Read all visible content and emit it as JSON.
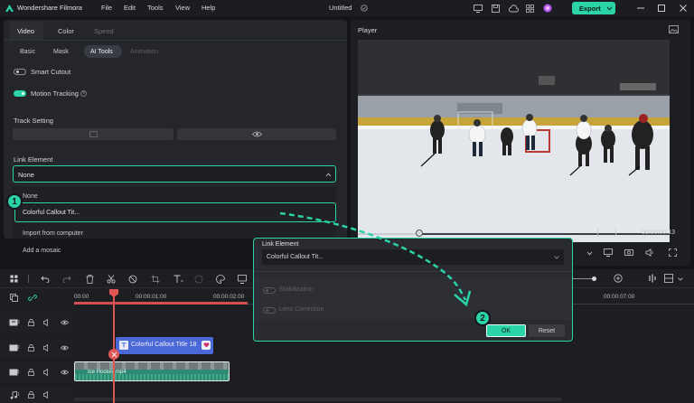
{
  "app": {
    "name": "Wondershare Filmora",
    "project_title": "Untitled",
    "accent": "#2ad4a6"
  },
  "menu": [
    "File",
    "Edit",
    "Tools",
    "View",
    "Help"
  ],
  "export_label": "Export",
  "left_panel": {
    "top_tabs": [
      "Video",
      "Color",
      "Speed"
    ],
    "sub_tabs": [
      "Basic",
      "Mask",
      "AI Tools",
      "Animation"
    ],
    "smart_cutout": "Smart Cutout",
    "motion_tracking": "Motion Tracking",
    "track_setting": "Track Setting",
    "link_element": "Link Element",
    "dropdown_value": "None",
    "dropdown_options": [
      "None",
      "Colorful Callout Tit...",
      "Import from computer",
      "Add a mosaic"
    ]
  },
  "player": {
    "title": "Player",
    "timecode": "00:00:00:13",
    "brackets": [
      "{",
      "}"
    ]
  },
  "timeline": {
    "ruler": [
      "00:00",
      "00:00:01:00",
      "00:00:02:00",
      "00:00:07:00"
    ],
    "title_clip": "Colorful Callout Title 18",
    "video_clip": "Ice Hockey.mp4",
    "tracks": [
      "3",
      "2",
      "1",
      "1"
    ]
  },
  "popup": {
    "label": "Link Element",
    "value": "Colorful Callout Tit...",
    "stabilization": "Stabilization",
    "lens_correction": "Lens Correction",
    "ok": "OK",
    "reset": "Reset"
  },
  "badges": [
    "1",
    "2"
  ]
}
